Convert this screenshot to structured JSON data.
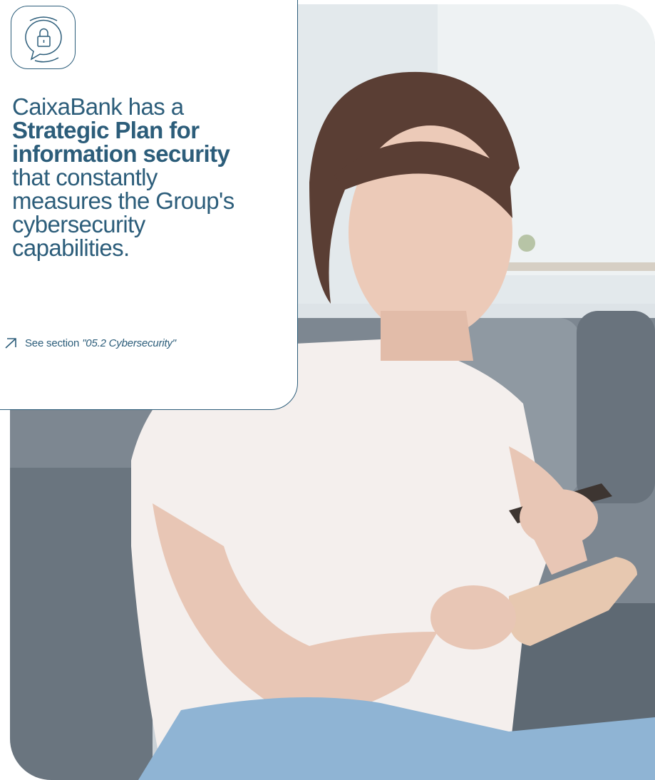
{
  "card": {
    "icon": "chat-lock-icon",
    "headline": {
      "line1": "CaixaBank has a",
      "bold1": "Strategic Plan for",
      "bold2": "information security",
      "line2": "that constantly",
      "line3": "measures the Group's",
      "line4": "cybersecurity",
      "line5": "capabilities."
    },
    "link": {
      "icon": "arrow-up-right-icon",
      "prefix": "See section",
      "reference": "\"05.2 Cybersecurity\""
    }
  },
  "colors": {
    "accent": "#2c5d7a",
    "background": "#ffffff"
  }
}
